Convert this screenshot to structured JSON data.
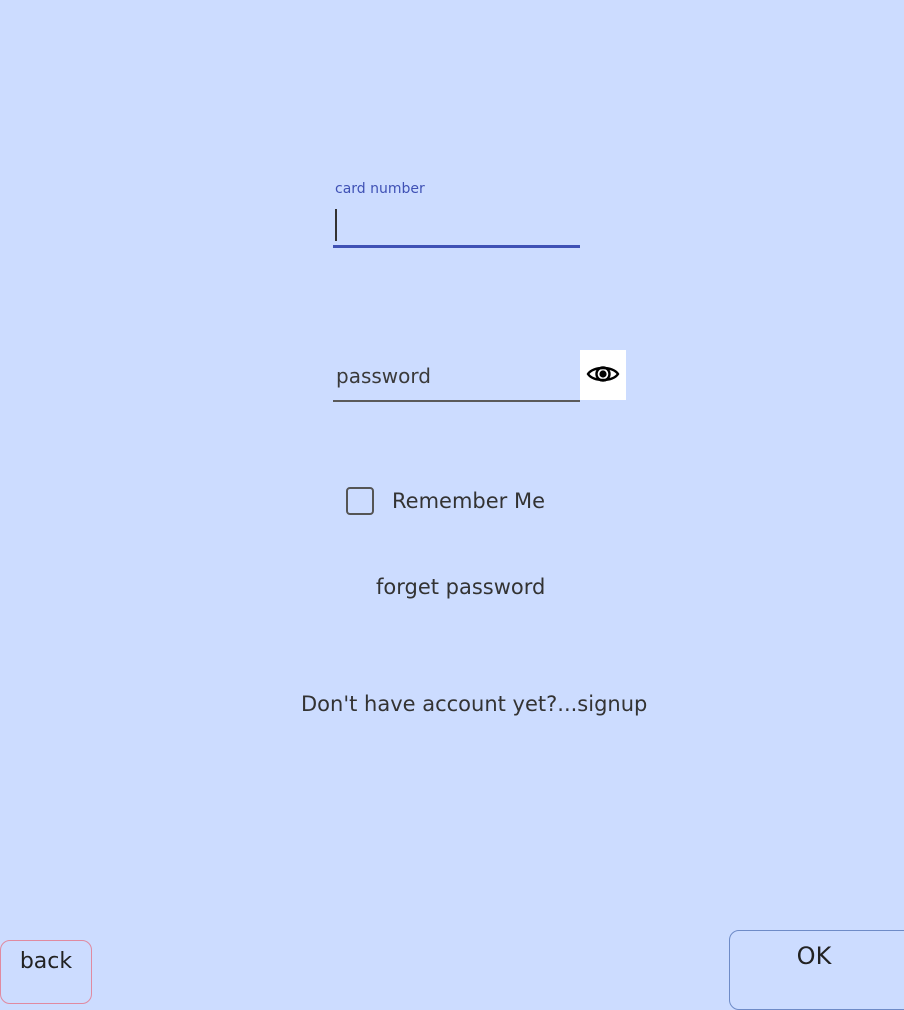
{
  "login_form": {
    "card_number": {
      "label": "card number",
      "value": ""
    },
    "password": {
      "placeholder": "password",
      "value": ""
    },
    "remember_me": {
      "label": "Remember Me",
      "checked": false
    },
    "forget_password_link": "forget password",
    "signup_link": "Don't have account yet?...signup"
  },
  "footer": {
    "back_label": "back",
    "ok_label": "OK"
  },
  "icons": {
    "password_toggle": "eye-icon"
  },
  "colors": {
    "background": "#ccdcff",
    "focus_accent": "#3f51b5",
    "back_border": "#e08aa0",
    "ok_border": "#6e8bc7"
  }
}
